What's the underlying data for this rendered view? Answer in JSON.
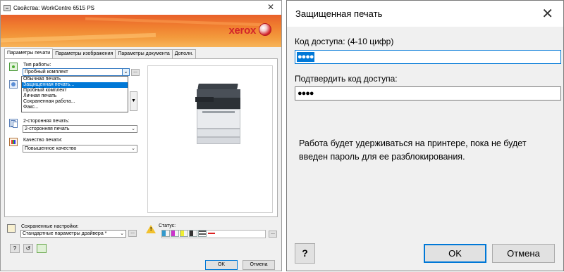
{
  "left_window": {
    "title": "Свойства: WorkCentre 6515 PS",
    "close_glyph": "✕",
    "brand": "xerox",
    "tabs": [
      "Параметры печати",
      "Параметры изображения",
      "Параметры документа",
      "Дополн."
    ],
    "job_type": {
      "label": "Тип работы:",
      "value": "Пробный комплект",
      "more": "...",
      "options": [
        "Обычная печать",
        "Защищенная печать...",
        "Пробный комплект",
        "Личная печать",
        "Сохраненная работа...",
        "Факс..."
      ],
      "selected_option": "Защищенная печать..."
    },
    "duplex": {
      "label": "2-сторонняя печать:",
      "value": "2-сторонняя печать"
    },
    "quality": {
      "label": "Качество печати:",
      "value": "Повышенное качество"
    },
    "saved_settings": {
      "label": "Сохраненные настройки:",
      "value": "Стандартные параметры драйвера *"
    },
    "status": {
      "label": "Статус:",
      "more": "..."
    },
    "help_button": "?",
    "ok_button": "OK",
    "cancel_button": "Отмена",
    "icons": [
      "job-type-icon",
      "paper-icon",
      "duplex-icon",
      "quality-icon",
      "saved-settings-icon",
      "warning-icon",
      "help-icon",
      "reset-icon",
      "eco-icon"
    ]
  },
  "right_dialog": {
    "title": "Защищенная печать",
    "close_glyph": "✕",
    "access_code": {
      "label": "Код доступа: (4-10 цифр)",
      "value": "●●●●"
    },
    "confirm_code": {
      "label": "Подтвердить код доступа:",
      "value": "●●●●"
    },
    "message": "Работа будет удерживаться на принтере, пока не будет введен пароль для ее разблокирования.",
    "help_button": "?",
    "ok_button": "OK",
    "cancel_button": "Отмена"
  },
  "colors": {
    "accent": "#0078d7",
    "banner": "#f07e2f",
    "xerox_red": "#d2232a"
  }
}
